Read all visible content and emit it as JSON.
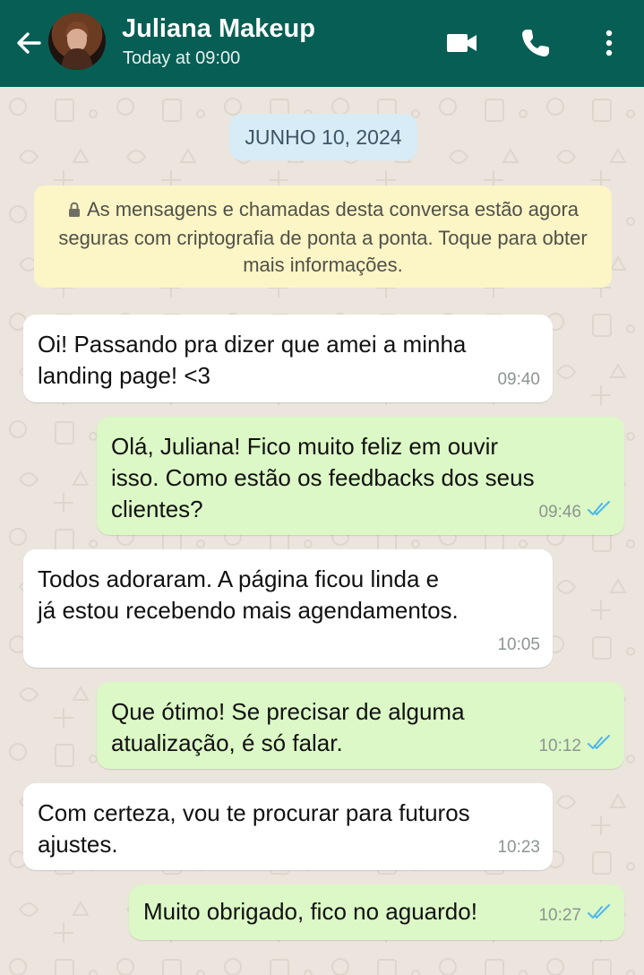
{
  "header": {
    "contact_name": "Juliana Makeup",
    "status": "Today at 09:00",
    "background_color": "#075e54",
    "icons": [
      "back-arrow-icon",
      "video-call-icon",
      "phone-icon",
      "more-options-icon"
    ]
  },
  "chat": {
    "date_chip": "JUNHO 10, 2024",
    "encryption_notice": "As mensagens e chamadas desta conversa estão agora seguras com criptografia de ponta a ponta. Toque para obter mais informações.",
    "messages": [
      {
        "direction": "incoming",
        "text": "Oi! Passando pra dizer que amei a minha\nlanding page! <3",
        "time": "09:40"
      },
      {
        "direction": "outgoing",
        "text": "Olá, Juliana! Fico muito feliz em ouvir\nisso. Como estão os feedbacks dos seus\nclientes?",
        "time": "09:46",
        "status": "read"
      },
      {
        "direction": "incoming",
        "text": "Todos adoraram. A página ficou linda e\njá estou recebendo mais agendamentos.",
        "time": "10:05"
      },
      {
        "direction": "outgoing",
        "text": "Que ótimo! Se precisar de alguma\natualização, é só falar.",
        "time": "10:12",
        "status": "read"
      },
      {
        "direction": "incoming",
        "text": "Com certeza, vou te procurar para futuros\najustes.",
        "time": "10:23"
      },
      {
        "direction": "outgoing",
        "text": "Muito obrigado, fico no aguardo!",
        "time": "10:27",
        "status": "read"
      }
    ]
  },
  "colors": {
    "incoming_bubble": "#ffffff",
    "outgoing_bubble": "#dcf8c6",
    "read_ticks": "#4fb6ec",
    "notice_background": "#fcf5c6",
    "date_chip_background": "#d7ecf6"
  }
}
